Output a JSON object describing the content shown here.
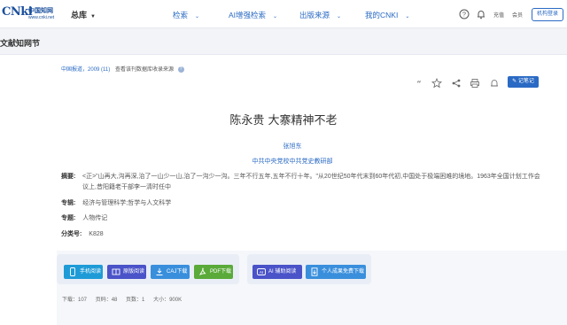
{
  "header": {
    "logo_mark": "CNki",
    "logo_cn": "中国知网",
    "logo_url": "www.cnki.net",
    "library": "总库",
    "nav": [
      "检索",
      "AI增强检索",
      "出版来源",
      "我的CNKI"
    ],
    "recharge": "充值",
    "member": "会员",
    "org_login": "机构登录"
  },
  "section": {
    "title": "文献知网节"
  },
  "article": {
    "source_prefix": "中国报道，",
    "source_issue": "2009 (11)",
    "source_index": "查看该刊数据库收录来源",
    "note_button": "记笔记",
    "title": "陈永贵 大寨精神不老",
    "author": "张旭东",
    "organization": "中共中央党校中共党史教研部",
    "abstract_label": "摘要:",
    "abstract": "<正>\"山再大,沟再深,治了一山少一山,治了一沟少一沟。三年不行五年,五年不行十年。\"从20世纪50年代末到60年代初,中国处于极端困难的境地。1963年全国计划工作会议上,昔阳籍老干部李一清时任中",
    "series_label": "专辑:",
    "series": "经济与管理科学;哲学与人文科学",
    "topic_label": "专题:",
    "topic": "人物传记",
    "class_label": "分类号:",
    "class": "K828"
  },
  "downloads": {
    "mobile": "手机阅读",
    "original": "原版阅读",
    "caj": "CAJ下载",
    "pdf": "PDF下载",
    "ai_read": "AI 辅助阅读",
    "personal": "个人成果免费下载"
  },
  "stats": {
    "downloads": "下载：107",
    "pages": "页码：48",
    "page_count": "页数：1",
    "size": "大小：900K"
  },
  "colors": {
    "brand": "#2a6ac4",
    "mobile_btn": "#1e9bd7",
    "original_btn": "#4a53c8",
    "caj_btn": "#3a8fdc",
    "pdf_btn": "#5aaa3a",
    "ai_btn": "#4a53c8",
    "personal_btn": "#3a8fdc"
  }
}
